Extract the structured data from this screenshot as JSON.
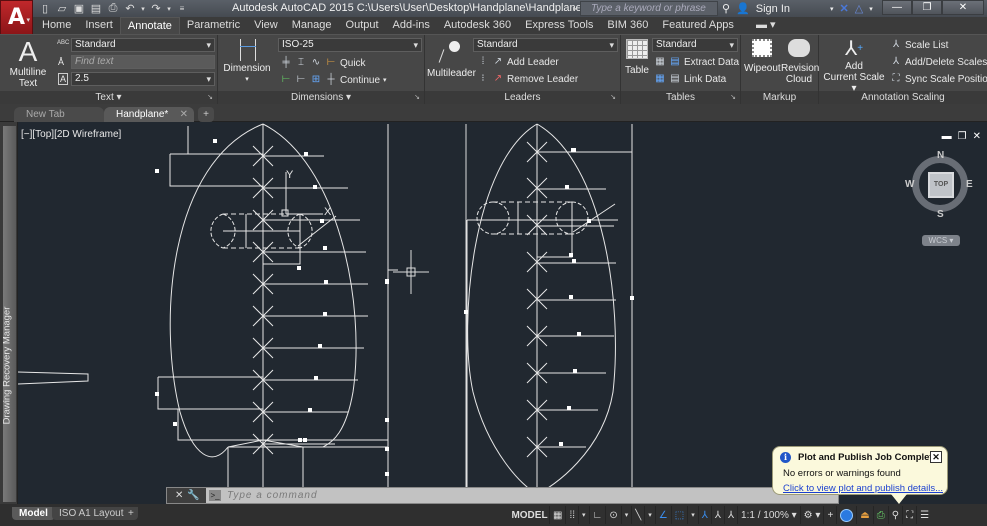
{
  "app": {
    "title": "Autodesk AutoCAD 2015    C:\\Users\\User\\Desktop\\Handplane\\Handplane.dwg",
    "app_button_letter": "A",
    "search_placeholder": "Type a keyword or phrase",
    "sign_in": "Sign In",
    "quick_access": [
      "new-icon",
      "open-icon",
      "save-icon",
      "save-as-icon",
      "plot-icon",
      "undo-icon",
      "redo-icon",
      "customize-icon"
    ]
  },
  "ribbon_tabs": [
    {
      "label": "Home",
      "active": false
    },
    {
      "label": "Insert",
      "active": false
    },
    {
      "label": "Annotate",
      "active": true
    },
    {
      "label": "Parametric",
      "active": false
    },
    {
      "label": "View",
      "active": false
    },
    {
      "label": "Manage",
      "active": false
    },
    {
      "label": "Output",
      "active": false
    },
    {
      "label": "Add-ins",
      "active": false
    },
    {
      "label": "Autodesk 360",
      "active": false
    },
    {
      "label": "Express Tools",
      "active": false
    },
    {
      "label": "BIM 360",
      "active": false
    },
    {
      "label": "Featured Apps",
      "active": false
    }
  ],
  "panels": {
    "text": {
      "label": "Text",
      "multiline_line1": "Multiline",
      "multiline_line2": "Text",
      "style": "Standard",
      "find_placeholder": "Find text",
      "height": "2.5"
    },
    "dimensions": {
      "label": "Dimensions",
      "big": "Dimension",
      "style": "ISO-25",
      "quick": "Quick",
      "continue": "Continue"
    },
    "leaders": {
      "label": "Leaders",
      "big": "Multileader",
      "style": "Standard",
      "add": "Add Leader",
      "remove": "Remove Leader"
    },
    "tables": {
      "label": "Tables",
      "big": "Table",
      "style": "Standard",
      "extract": "Extract Data",
      "link": "Link Data"
    },
    "markup": {
      "label": "Markup",
      "wipeout": "Wipeout",
      "revision_line1": "Revision",
      "revision_line2": "Cloud"
    },
    "annotation_scaling": {
      "label": "Annotation Scaling",
      "add_line1": "Add",
      "add_line2": "Current Scale",
      "scale_list": "Scale List",
      "add_delete": "Add/Delete Scales",
      "sync": "Sync Scale Positions"
    }
  },
  "doc_tabs": [
    {
      "label": "New Tab",
      "active": false
    },
    {
      "label": "Handplane*",
      "active": true
    }
  ],
  "side_palette": "Drawing Recovery Manager",
  "viewport": {
    "label": "[−][Top][2D Wireframe]",
    "viewcube": {
      "face": "TOP",
      "n": "N",
      "s": "S",
      "e": "E",
      "w": "W",
      "wcs": "WCS"
    },
    "ucs": {
      "x": "X",
      "y": "Y"
    }
  },
  "command_line": {
    "placeholder": "Type a command"
  },
  "layout_tabs": [
    {
      "label": "Model",
      "active": true
    },
    {
      "label": "ISO A1 Layout",
      "active": false
    }
  ],
  "status_bar": {
    "model": "MODEL",
    "scale": "1:1 / 100%"
  },
  "notification": {
    "title": "Plot and Publish Job Complete",
    "message": "No errors or warnings found",
    "link": "Click to view plot and publish details..."
  }
}
